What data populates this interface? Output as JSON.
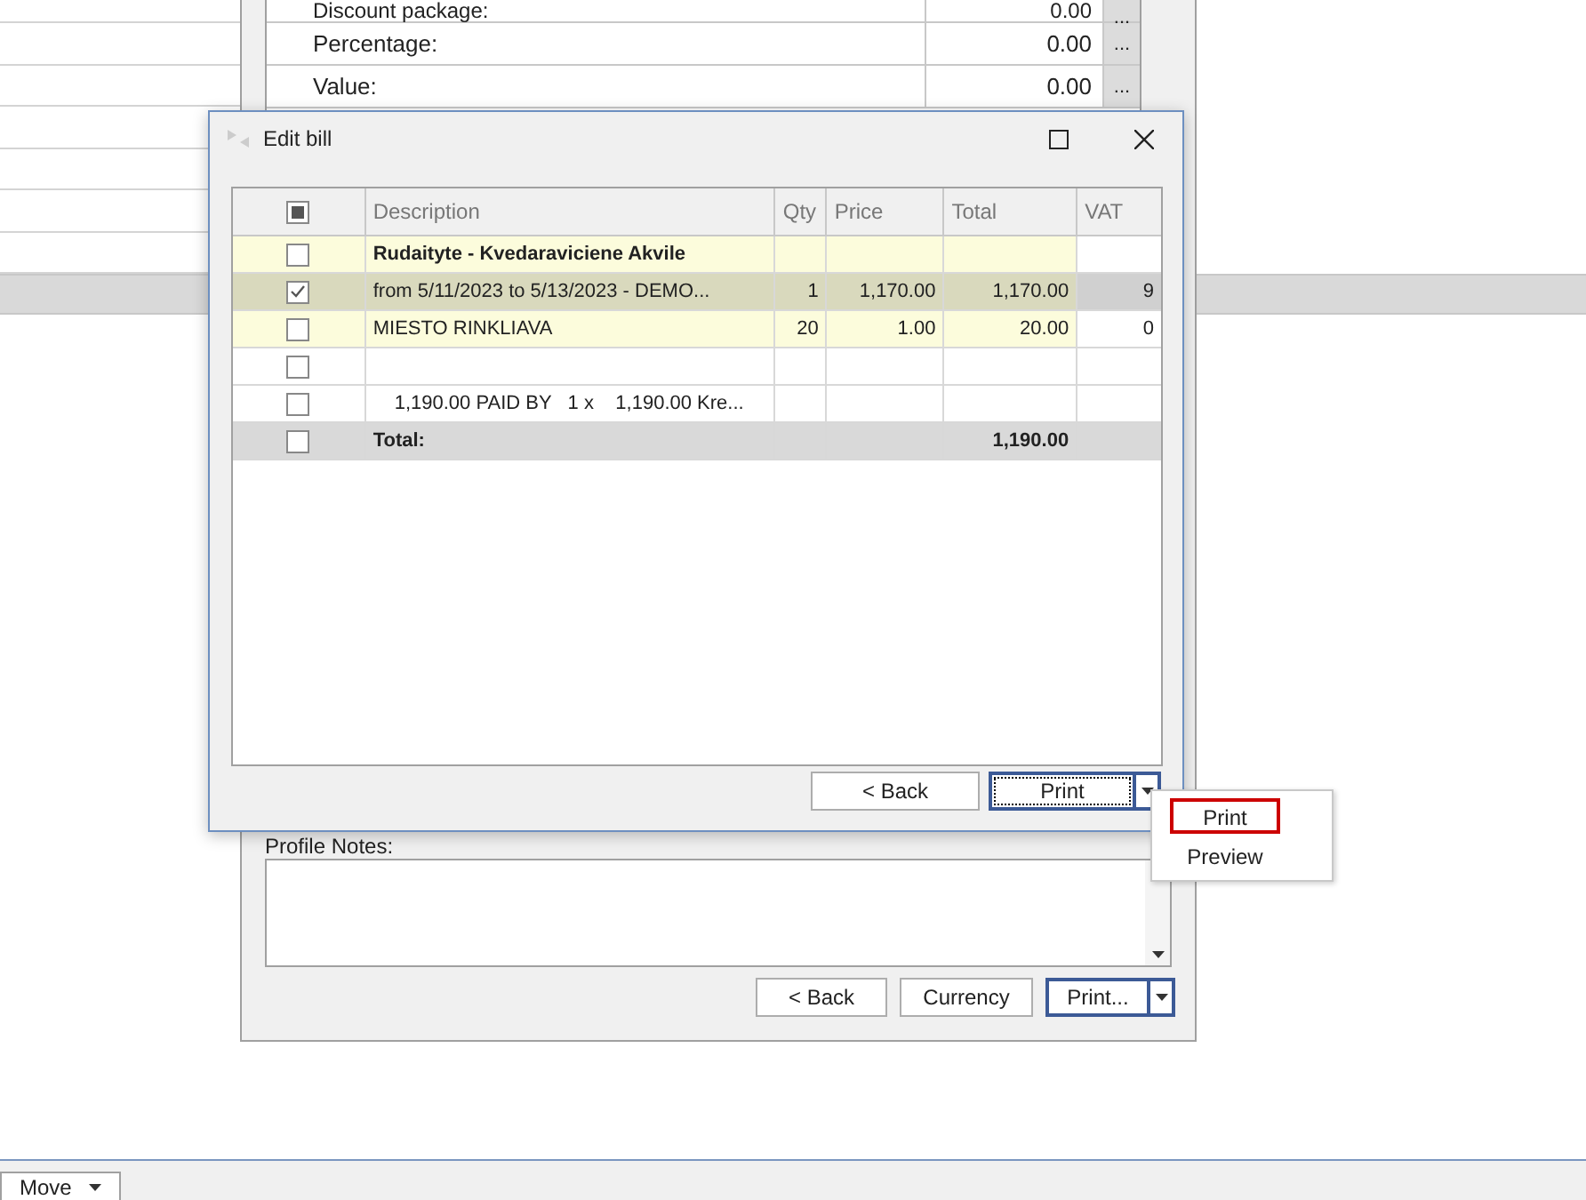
{
  "background_grid": {
    "selected_row": true
  },
  "form": {
    "fields": [
      {
        "label": "Discount package:",
        "value": "0.00",
        "button": "..."
      },
      {
        "label": "Percentage:",
        "value": "0.00",
        "button": "..."
      },
      {
        "label": "Value:",
        "value": "0.00",
        "button": "..."
      }
    ],
    "notes_label": "Profile Notes:",
    "buttons": [
      {
        "label": "< Back",
        "kind": "plain"
      },
      {
        "label": "Currency",
        "kind": "plain"
      },
      {
        "label": "Print...",
        "kind": "split"
      }
    ]
  },
  "dialog": {
    "title": "Edit bill",
    "header_checkbox": {
      "indeterminate": true
    },
    "columns": [
      "Description",
      "Qty",
      "Price",
      "Total",
      "VAT"
    ],
    "rows": [
      {
        "kind": "group",
        "checked": false,
        "selected": false,
        "description": "Rudaityte - Kvedaraviciene Akvile"
      },
      {
        "kind": "item",
        "checked": true,
        "selected": true,
        "description": "from 5/11/2023 to 5/13/2023 - DEMO...",
        "qty": "1",
        "price": "1,170.00",
        "total": "1,170.00",
        "vat": "9"
      },
      {
        "kind": "item",
        "checked": false,
        "selected": false,
        "description": "MIESTO RINKLIAVA",
        "qty": "20",
        "price": "1.00",
        "total": "20.00",
        "vat": "0"
      },
      {
        "kind": "blank",
        "checked": false,
        "selected": false
      },
      {
        "kind": "payment",
        "checked": false,
        "selected": false,
        "description": "1,190.00 PAID BY   1 x    1,190.00 Kre..."
      },
      {
        "kind": "total",
        "checked": false,
        "selected": false,
        "description": "Total:",
        "total": "1,190.00"
      }
    ],
    "buttons": [
      {
        "label": "< Back",
        "kind": "plain"
      },
      {
        "label": "Print",
        "kind": "split"
      }
    ],
    "menu": [
      {
        "label": "Print",
        "selected": true
      },
      {
        "label": "Preview",
        "selected": false
      }
    ]
  },
  "bottom_tabs": [
    {
      "label": "Move"
    }
  ]
}
